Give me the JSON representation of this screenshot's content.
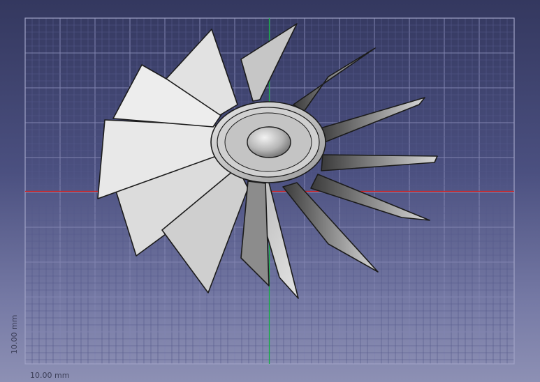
{
  "viewport": {
    "grid_colors": {
      "minor": "#55598a",
      "major": "#8184b0",
      "frame": "#9fa2c5"
    },
    "axis_colors": {
      "x": "#d42020",
      "y": "#10b040"
    },
    "scale": {
      "x_label": "10.00 mm",
      "y_label": "10.00 mm"
    },
    "model": {
      "name": "impeller",
      "blade_count": 13,
      "hub": "center-hub"
    }
  }
}
